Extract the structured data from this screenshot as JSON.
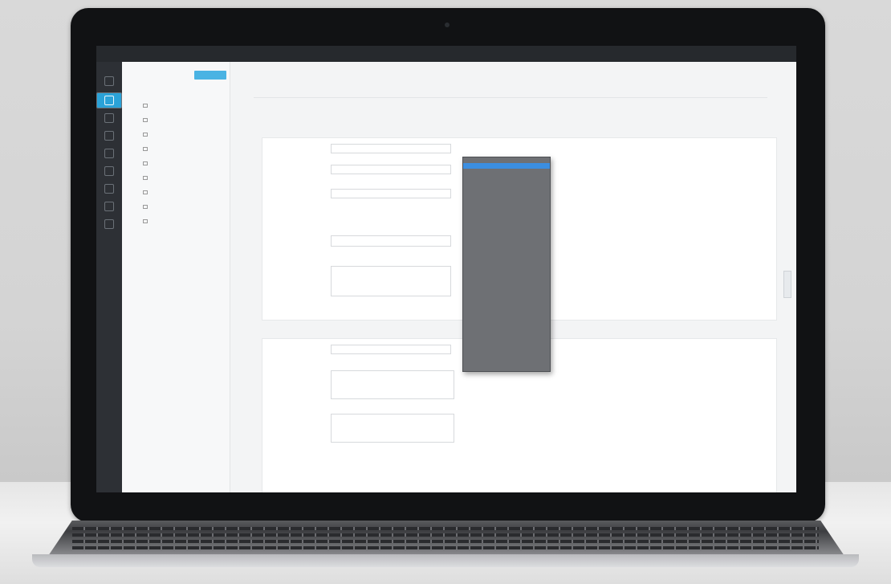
{
  "topbar": {
    "brand": "",
    "items": [
      "",
      "",
      ""
    ],
    "right": ""
  },
  "sidebar": {
    "title": "",
    "subtitle": "",
    "new_button": "",
    "items": [
      "",
      "",
      "",
      "",
      "",
      "",
      "",
      "",
      ""
    ]
  },
  "main": {
    "title": "",
    "breadcrumb": "",
    "section1_title": "",
    "section2_title": "",
    "link_text": "",
    "status_text": ""
  },
  "dropdown": {
    "items": [
      "",
      "",
      "",
      "",
      "",
      "",
      "",
      "",
      "",
      "",
      "",
      "",
      "",
      "",
      "",
      "",
      "",
      "",
      "",
      "",
      "",
      "",
      "",
      "",
      "",
      "",
      "",
      "",
      "",
      "",
      "",
      "",
      "",
      "",
      "",
      ""
    ]
  },
  "colors": {
    "accent": "#2aa2d8",
    "dropdown_bg": "#6e7074",
    "dropdown_selected": "#3b8ee0",
    "success": "#3d9a49",
    "topbar_bg": "#26292d",
    "rail_bg": "#2d3035"
  }
}
